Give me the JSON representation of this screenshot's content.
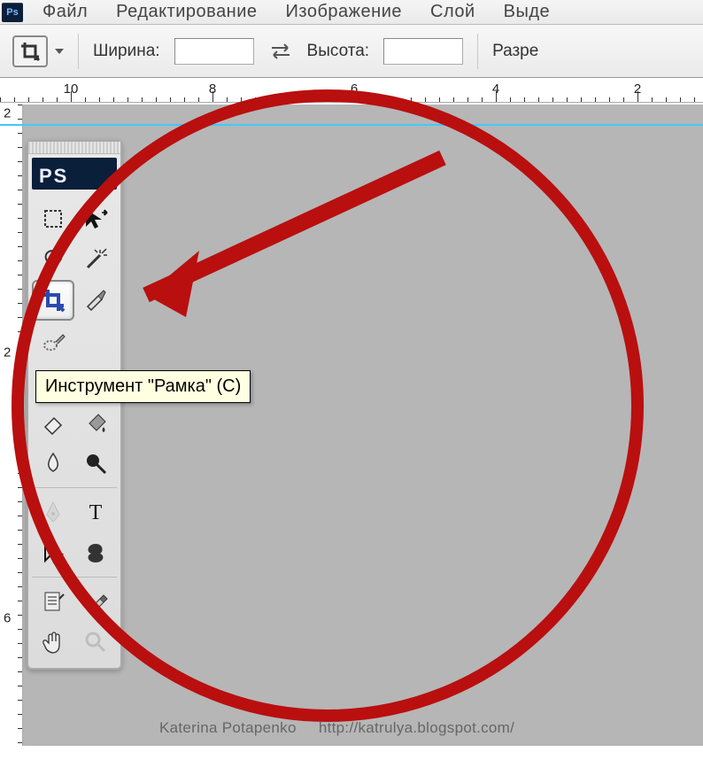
{
  "menubar": {
    "items": [
      "Файл",
      "Редактирование",
      "Изображение",
      "Слой",
      "Выде"
    ]
  },
  "optionsbar": {
    "width_label": "Ширина:",
    "height_label": "Высота:",
    "resolution_label": "Разре"
  },
  "rulers": {
    "h_values": [
      "10",
      "8",
      "6",
      "4",
      "2"
    ],
    "v_values": [
      "2",
      "2",
      "6"
    ]
  },
  "tools_panel": {
    "title": "PS",
    "tooltip": "Инструмент \"Рамка\" (C)",
    "tools": [
      {
        "name": "rectangular-marquee-icon"
      },
      {
        "name": "move-icon"
      },
      {
        "name": "lasso-icon"
      },
      {
        "name": "magic-wand-icon"
      },
      {
        "name": "crop-icon",
        "selected": true
      },
      {
        "name": "slice-icon"
      },
      {
        "name": "healing-brush-icon",
        "span2": true
      },
      {
        "name": "clone-stamp-icon"
      },
      {
        "name": "history-brush-icon"
      },
      {
        "name": "eraser-icon"
      },
      {
        "name": "paint-bucket-icon"
      },
      {
        "name": "blur-icon"
      },
      {
        "name": "dodge-icon"
      },
      {
        "sep": true
      },
      {
        "name": "pen-icon",
        "disabled": true
      },
      {
        "name": "type-icon"
      },
      {
        "name": "path-selection-icon"
      },
      {
        "name": "custom-shape-icon"
      },
      {
        "sep": true
      },
      {
        "name": "notes-icon"
      },
      {
        "name": "eyedropper-icon"
      },
      {
        "name": "hand-icon"
      },
      {
        "name": "zoom-icon",
        "disabled": true
      }
    ]
  },
  "annotation": {
    "circle_color": "#b90f0f",
    "arrow_color": "#b90f0f"
  },
  "credit": {
    "author": "Katerina Potapenko",
    "url": "http://katrulya.blogspot.com/"
  }
}
